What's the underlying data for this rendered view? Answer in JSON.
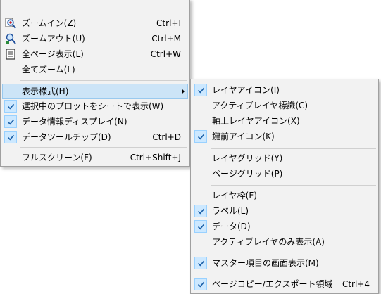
{
  "main_menu": {
    "zoom_in": {
      "label": "ズームイン(Z)",
      "shortcut": "Ctrl+I",
      "icon": "zoom-in-icon"
    },
    "zoom_out": {
      "label": "ズームアウト(U)",
      "shortcut": "Ctrl+M",
      "icon": "zoom-out-icon"
    },
    "whole_page": {
      "label": "全ページ表示(L)",
      "shortcut": "Ctrl+W",
      "icon": "page-icon"
    },
    "zoom_all": {
      "label": "全てズーム(L)"
    },
    "display_style": {
      "label": "表示様式(H)"
    },
    "plot_on_sheet": {
      "label": "選択中のプロットをシートで表示(W)",
      "checked": true
    },
    "data_info": {
      "label": "データ情報ディスプレイ(N)",
      "checked": true
    },
    "data_tooltip": {
      "label": "データツールチップ(D)",
      "shortcut": "Ctrl+D",
      "checked": true
    },
    "fullscreen": {
      "label": "フルスクリーン(F)",
      "shortcut": "Ctrl+Shift+J"
    }
  },
  "sub_menu": {
    "layer_icon": {
      "label": "レイヤアイコン(I)",
      "checked": true
    },
    "active_layer_marker": {
      "label": "アクティブレイヤ標識(C)",
      "checked": false
    },
    "axis_layer_icon": {
      "label": "軸上レイヤアイコン(X)",
      "checked": false
    },
    "lock_icon": {
      "label": "鍵前アイコン(K)",
      "checked": true
    },
    "layer_grid": {
      "label": "レイヤグリッド(Y)",
      "checked": false
    },
    "page_grid": {
      "label": "ページグリッド(P)",
      "checked": false
    },
    "layer_frame": {
      "label": "レイヤ枠(F)",
      "checked": false
    },
    "label": {
      "label": "ラベル(L)",
      "checked": true
    },
    "data": {
      "label": "データ(D)",
      "checked": true
    },
    "active_layer_only": {
      "label": "アクティブレイヤのみ表示(A)",
      "checked": false
    },
    "master_items": {
      "label": "マスター項目の画面表示(M)",
      "checked": true
    },
    "page_copy_export": {
      "label": "ページコピー/エクスポート領域",
      "shortcut": "Ctrl+4",
      "checked": true
    }
  },
  "colors": {
    "menu_bg": "#f2f2f2",
    "highlight_bg": "#cce4f7",
    "check_bg": "#cce8ff",
    "check_mark": "#1a5fa8"
  }
}
